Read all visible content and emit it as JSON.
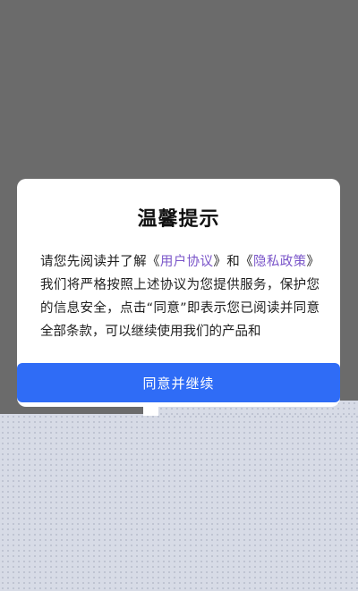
{
  "dialog": {
    "title": "温馨提示",
    "body": {
      "text_1": "请您先阅读并了解《",
      "link_user_agreement": "用户协议",
      "text_2": "》和《",
      "link_privacy_policy": "隐私政策",
      "text_3": "》我们将严格按照上述协议为您提供服务，保护您的信息安全，点击“同意”即表示您已阅读并同意全部条款，可以继续使用我们的产品和"
    },
    "agree_button_label": "同意并继续"
  },
  "colors": {
    "overlay": "#6b6b6b",
    "button": "#2f6cf6",
    "link": "#7a55c9"
  }
}
